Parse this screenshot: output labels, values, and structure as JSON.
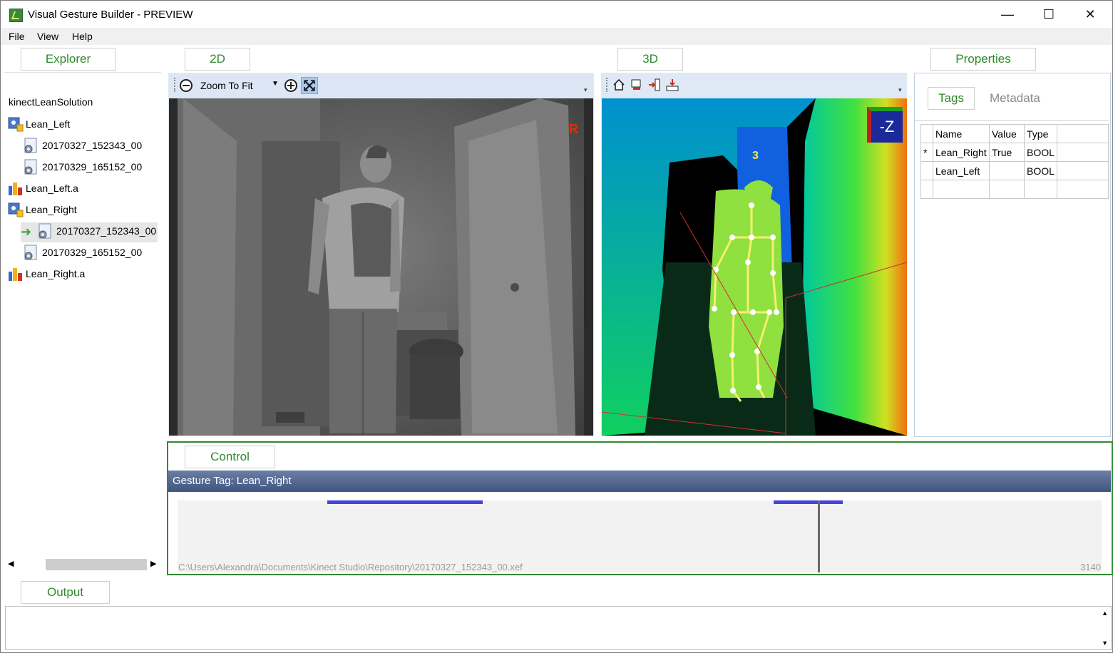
{
  "window": {
    "title": "Visual Gesture Builder - PREVIEW",
    "minimize": "—",
    "maximize": "☐",
    "close": "✕"
  },
  "menu": [
    "File",
    "View",
    "Help"
  ],
  "explorer": {
    "tab": "Explorer",
    "solution": "kinectLeanSolution",
    "items": [
      {
        "label": "Lean_Left",
        "icon": "gesture-project-icon"
      },
      {
        "label": "20170327_152343_00",
        "icon": "clip-file-icon"
      },
      {
        "label": "20170329_165152_00",
        "icon": "clip-file-icon"
      },
      {
        "label": "Lean_Left.a",
        "icon": "database-icon"
      },
      {
        "label": "Lean_Right",
        "icon": "gesture-project-icon"
      },
      {
        "label": "20170327_152343_00",
        "icon": "clip-file-icon"
      },
      {
        "label": "20170329_165152_00",
        "icon": "clip-file-icon"
      },
      {
        "label": "Lean_Right.a",
        "icon": "database-icon"
      }
    ],
    "scroll_left": "◀",
    "scroll_right": "▶"
  },
  "view2d": {
    "tab": "2D",
    "zoom_value": "Zoom To Fit",
    "recording_badge": "R",
    "icons": [
      "zoom-out-icon",
      "zoom-in-icon",
      "fit-to-window-icon"
    ]
  },
  "view3d": {
    "tab": "3D",
    "orientation_label": "-Z",
    "body_index": "3",
    "icons": [
      "home-view-icon",
      "camera-view-icon",
      "side-view-icon",
      "top-view-icon"
    ]
  },
  "properties": {
    "tab": "Properties",
    "subtabs": [
      "Tags",
      "Metadata"
    ],
    "columns": [
      "Name",
      "Value",
      "Type"
    ],
    "rows": [
      {
        "marker": "*",
        "name": "Lean_Right",
        "value": "True",
        "type": "BOOL"
      },
      {
        "marker": "",
        "name": "Lean_Left",
        "value": "",
        "type": "BOOL"
      },
      {
        "marker": "",
        "name": "",
        "value": "",
        "type": ""
      }
    ]
  },
  "control": {
    "tab": "Control",
    "gesture_tag": "Gesture Tag: Lean_Right",
    "file_path": "C:\\Users\\Alexandra\\Documents\\Kinect Studio\\Repository\\20170327_152343_00.xef",
    "frame_count": "3140",
    "tagged_ranges": [
      [
        0.162,
        0.33
      ],
      [
        0.645,
        0.72
      ]
    ],
    "playhead": 0.693,
    "tag_color": "#4444dd"
  },
  "output": {
    "tab": "Output",
    "scroll_up": "▲",
    "scroll_down": "▼"
  },
  "colors": {
    "accent_green": "#2f8a2f",
    "toolbar_blue": "#dce6f4"
  }
}
